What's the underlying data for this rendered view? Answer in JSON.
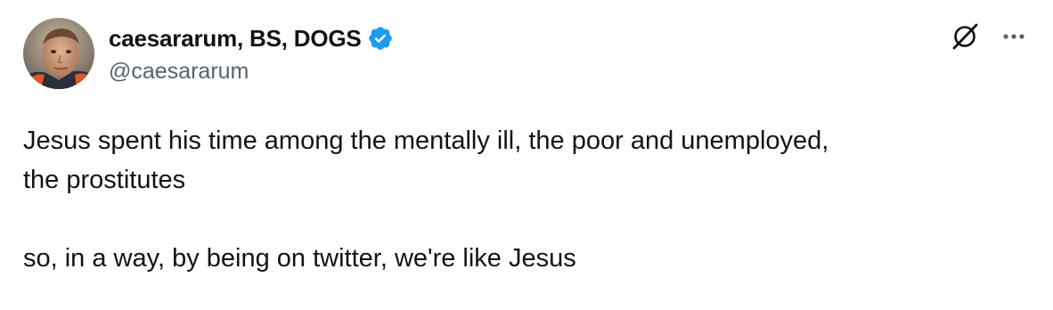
{
  "author": {
    "display_name": "caesararum, BS, DOGS",
    "handle": "@caesararum",
    "verified": true,
    "verified_color": "#1d9bf0"
  },
  "header_actions": {
    "grok_icon": "grok-icon",
    "more_icon": "more-icon"
  },
  "tweet": {
    "line1": "Jesus spent his time among the mentally ill, the poor and unemployed,",
    "line2": "the prostitutes",
    "line3": "so, in a way, by being on twitter, we're like Jesus"
  },
  "colors": {
    "text_primary": "#0f1419",
    "text_secondary": "#536471"
  }
}
